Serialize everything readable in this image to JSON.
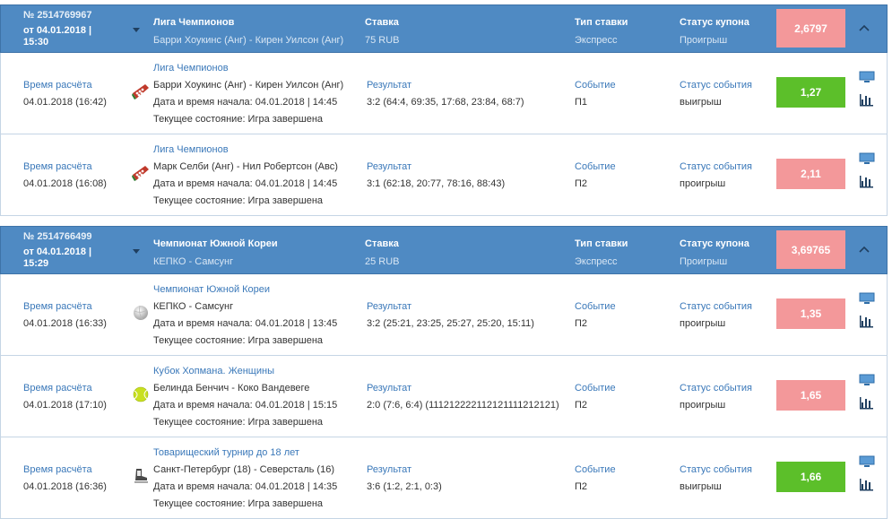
{
  "coupons": [
    {
      "number": "№ 2514769967",
      "date_line1": "от 04.01.2018 |",
      "date_line2": "15:30",
      "header_league": "Лига Чемпионов",
      "header_teams": "Барри Хоукинс (Анг) - Кирен Уилсон (Анг)",
      "stake_label": "Ставка",
      "stake_value": "75 RUB",
      "type_label": "Тип ставки",
      "type_value": "Экспресс",
      "status_label": "Статус купона",
      "status_value": "Проигрыш",
      "total_coef": "2,6797",
      "events": [
        {
          "calc_label": "Время расчёта",
          "calc_date": "04.01.2018 (16:42)",
          "sport_icon": "snooker-icon",
          "league": "Лига Чемпионов",
          "teams": "Барри Хоукинс (Анг) - Кирен Уилсон (Анг)",
          "start": "Дата и время начала: 04.01.2018 | 14:45",
          "state": "Текущее состояние: Игра завершена",
          "result_label": "Результат",
          "result_value": "3:2 (64:4, 69:35, 17:68, 23:84, 68:7)",
          "event_label": "Событие",
          "event_value": "П1",
          "status_label": "Статус события",
          "status_value": "выигрыш",
          "odd": "1,27",
          "outcome": "win"
        },
        {
          "calc_label": "Время расчёта",
          "calc_date": "04.01.2018 (16:08)",
          "sport_icon": "snooker-icon",
          "league": "Лига Чемпионов",
          "teams": "Марк Селби (Анг) - Нил Робертсон (Авс)",
          "start": "Дата и время начала: 04.01.2018 | 14:45",
          "state": "Текущее состояние: Игра завершена",
          "result_label": "Результат",
          "result_value": "3:1 (62:18, 20:77, 78:16, 88:43)",
          "event_label": "Событие",
          "event_value": "П2",
          "status_label": "Статус события",
          "status_value": "проигрыш",
          "odd": "2,11",
          "outcome": "lose"
        }
      ]
    },
    {
      "number": "№ 2514766499",
      "date_line1": "от 04.01.2018 |",
      "date_line2": "15:29",
      "header_league": "Чемпионат Южной Кореи",
      "header_teams": "КЕПКО - Самсунг",
      "stake_label": "Ставка",
      "stake_value": "25 RUB",
      "type_label": "Тип ставки",
      "type_value": "Экспресс",
      "status_label": "Статус купона",
      "status_value": "Проигрыш",
      "total_coef": "3,69765",
      "events": [
        {
          "calc_label": "Время расчёта",
          "calc_date": "04.01.2018 (16:33)",
          "sport_icon": "volleyball-icon",
          "league": "Чемпионат Южной Кореи",
          "teams": "КЕПКО - Самсунг",
          "start": "Дата и время начала: 04.01.2018 | 13:45",
          "state": "Текущее состояние: Игра завершена",
          "result_label": "Результат",
          "result_value": "3:2 (25:21, 23:25, 25:27, 25:20, 15:11)",
          "event_label": "Событие",
          "event_value": "П2",
          "status_label": "Статус события",
          "status_value": "проигрыш",
          "odd": "1,35",
          "outcome": "lose"
        },
        {
          "calc_label": "Время расчёта",
          "calc_date": "04.01.2018 (17:10)",
          "sport_icon": "tennis-ball-icon",
          "league": "Кубок Хопмана. Женщины",
          "teams": "Белинда Бенчич - Коко Вандевеге",
          "start": "Дата и время начала: 04.01.2018 | 15:15",
          "state": "Текущее состояние: Игра завершена",
          "result_label": "Результат",
          "result_value": "2:0 (7:6, 6:4) (111212222112121111212121)",
          "event_label": "Событие",
          "event_value": "П2",
          "status_label": "Статус события",
          "status_value": "проигрыш",
          "odd": "1,65",
          "outcome": "lose"
        },
        {
          "calc_label": "Время расчёта",
          "calc_date": "04.01.2018 (16:36)",
          "sport_icon": "hockey-skate-icon",
          "league": "Товарищеский турнир до 18 лет",
          "teams": "Санкт-Петербург (18) - Северсталь (16)",
          "start": "Дата и время начала: 04.01.2018 | 14:35",
          "state": "Текущее состояние: Игра завершена",
          "result_label": "Результат",
          "result_value": "3:6 (1:2, 2:1, 0:3)",
          "event_label": "Событие",
          "event_value": "П2",
          "status_label": "Статус события",
          "status_value": "выигрыш",
          "odd": "1,66",
          "outcome": "win"
        }
      ]
    }
  ],
  "colors": {
    "header_bg": "#4f8ac3",
    "link_blue": "#3a78b9",
    "win_green": "#5cbf2a",
    "lose_pink": "#f3989a"
  }
}
